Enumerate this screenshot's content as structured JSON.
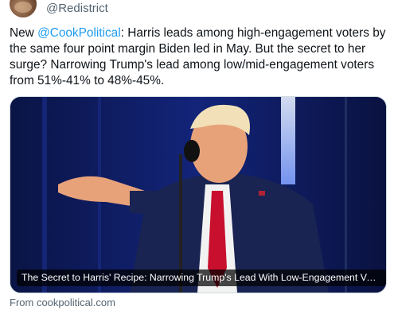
{
  "author": {
    "handle": "@Redistrict",
    "avatar_icon": "profile-avatar"
  },
  "tweet": {
    "text_prefix": "New ",
    "mention": "@CookPolitical",
    "text_body": ": Harris leads among high-engagement voters by the same four point margin Biden led in May. But the secret to her surge? Narrowing Trump's lead among low/mid-engagement voters from 51%-41% to 48%-45%.",
    "mention_color": "#1d9bf0"
  },
  "card": {
    "image_subject": "man-at-podium-photo",
    "caption": "The Secret to Harris' Recipe: Narrowing Trump's Lead With Low-Engagement Voters | Co...",
    "source": "From cookpolitical.com"
  }
}
